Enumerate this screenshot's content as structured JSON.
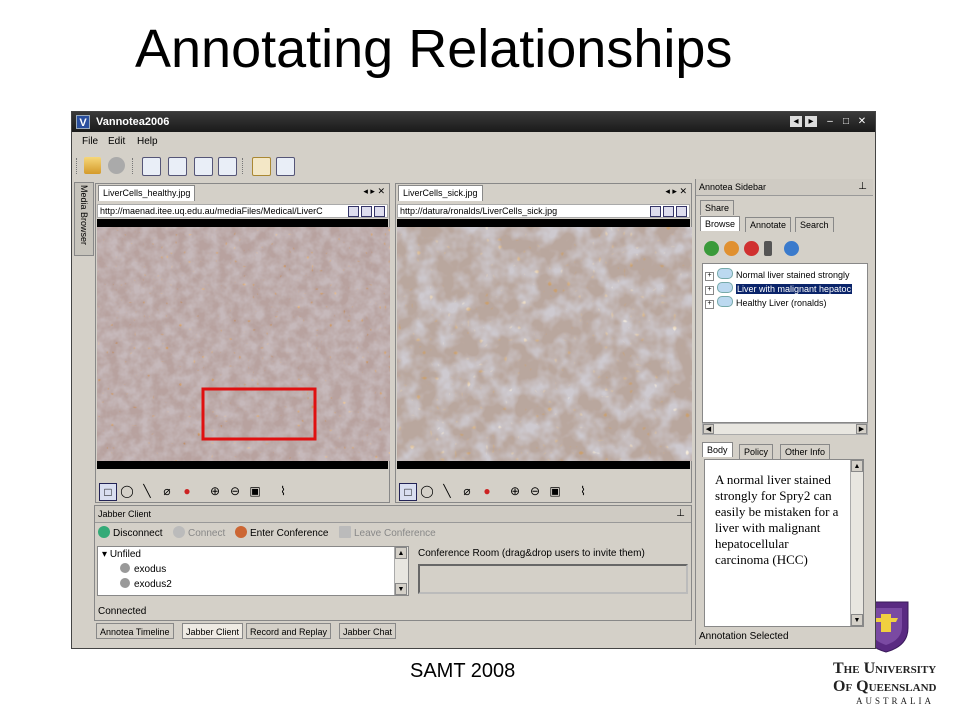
{
  "slide": {
    "title": "Annotating Relationships",
    "footer": "SAMT 2008",
    "institution": "The University of Queensland",
    "institution_country": "AUSTRALIA"
  },
  "window": {
    "title": "Vannotea2006",
    "icon": "V",
    "controls": [
      "back-icon",
      "forward-icon",
      "minimize-icon",
      "maximize-icon",
      "close-icon"
    ]
  },
  "menu": [
    "File",
    "Edit",
    "Help"
  ],
  "toolbar_icons": [
    "open-folder-icon",
    "record-icon",
    "doc1-icon",
    "doc2-icon",
    "doc3-icon",
    "doc4-icon",
    "doc5-icon",
    "doc6-icon"
  ],
  "left_strip": {
    "label": "Media Browser"
  },
  "panels": [
    {
      "tab": "LiverCells_healthy.jpg",
      "url": "http://maenad.itee.uq.edu.au/mediaFiles/Medical/LiverC",
      "has_annotation_box": true
    },
    {
      "tab": "LiverCells_sick.jpg",
      "url": "http://datura/ronalds/LiverCells_sick.jpg",
      "has_annotation_box": false
    }
  ],
  "panel_controls": {
    "prev": "◂",
    "next": "▸",
    "close": "✕"
  },
  "draw_tools": [
    "rectangle-tool-icon",
    "ellipse-tool-icon",
    "line-tool-icon",
    "eraser-icon",
    "color-icon",
    "zoom-in-icon",
    "zoom-out-icon",
    "fit-icon",
    "attach-icon"
  ],
  "jabber": {
    "header": "Jabber Client",
    "toolbar": {
      "disconnect": "Disconnect",
      "connect": "Connect",
      "enter_conference": "Enter Conference",
      "leave_conference": "Leave Conference"
    },
    "group": "Unfiled",
    "users": [
      "exodus",
      "exodus2"
    ],
    "conference_label": "Conference Room (drag&drop users to invite them)",
    "status": "Connected"
  },
  "bottom_tabs": [
    "Annotea Timeline",
    "Jabber Client",
    "Record and Replay",
    "Jabber Chat"
  ],
  "sidebar": {
    "header": "Annotea Sidebar",
    "top_tabs": [
      "Share",
      "Browse",
      "Annotate",
      "Search"
    ],
    "tree": [
      {
        "label": "Normal liver stained strongly",
        "selected": false
      },
      {
        "label": "Liver with malignant hepatoc",
        "selected": true
      },
      {
        "label": "Healthy Liver (ronalds)",
        "selected": false
      }
    ],
    "detail_tabs": [
      "Body",
      "Policy",
      "Other Info"
    ],
    "body_text": "A normal liver stained strongly for Spry2 can easily be mistaken for a liver with malignant hepatocellular carcinoma (HCC)",
    "status": "Annotation Selected"
  },
  "colors": {
    "annotation_box": "#e01010",
    "selection": "#0a246a",
    "title_bar": "#222222"
  }
}
